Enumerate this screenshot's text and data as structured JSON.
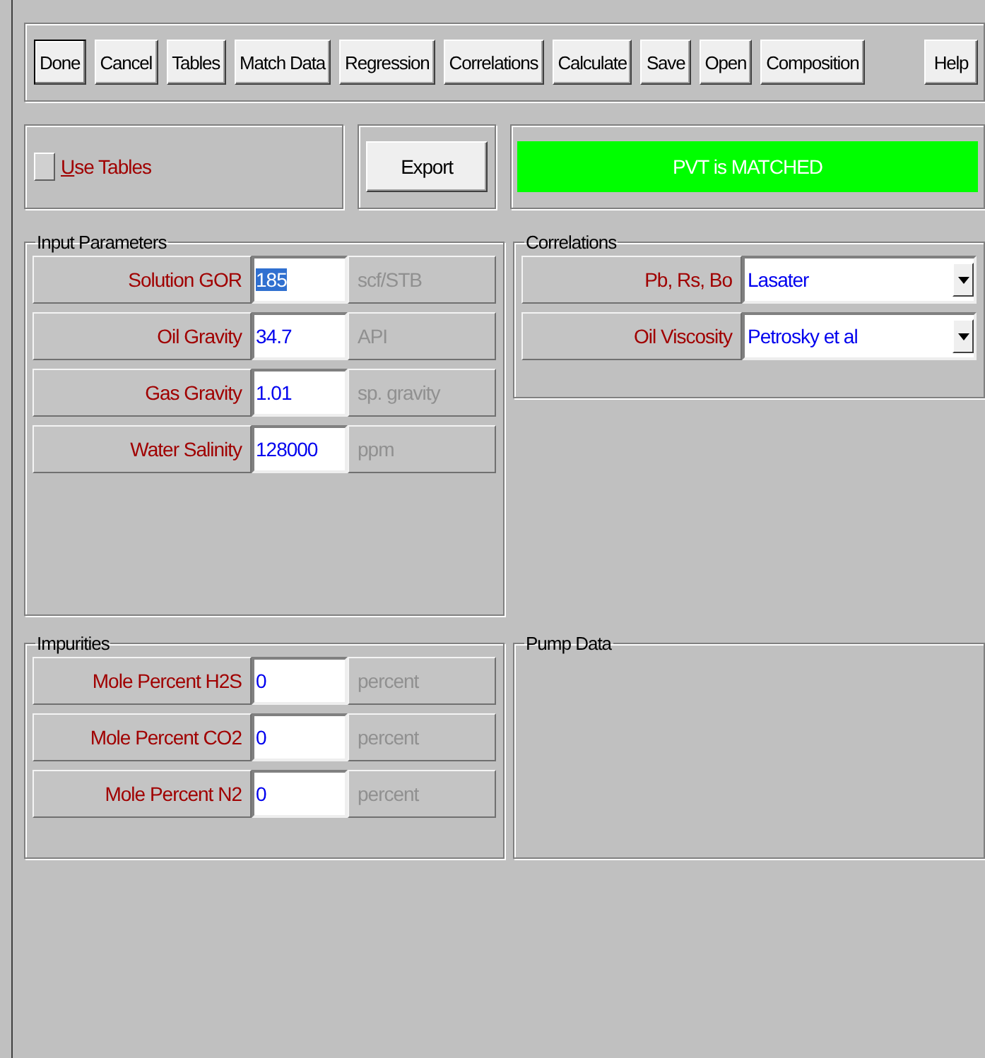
{
  "toolbar": {
    "buttons": [
      {
        "label": "Done",
        "default": true
      },
      {
        "label": "Cancel",
        "default": false
      },
      {
        "label": "Tables",
        "default": false
      },
      {
        "label": "Match Data",
        "default": false
      },
      {
        "label": "Regression",
        "default": false
      },
      {
        "label": "Correlations",
        "default": false
      },
      {
        "label": "Calculate",
        "default": false
      },
      {
        "label": "Save",
        "default": false
      },
      {
        "label": "Open",
        "default": false
      },
      {
        "label": "Composition",
        "default": false
      }
    ],
    "help_button": "Help"
  },
  "use_tables": {
    "label": "Use Tables",
    "checked": false
  },
  "export_button": "Export",
  "status": {
    "text": "PVT is MATCHED",
    "color": "#00ff00"
  },
  "input_parameters": {
    "title": "Input Parameters",
    "rows": [
      {
        "label": "Solution GOR",
        "value": "185",
        "unit": "scf/STB",
        "highlighted": true
      },
      {
        "label": "Oil Gravity",
        "value": "34.7",
        "unit": "API",
        "highlighted": false
      },
      {
        "label": "Gas Gravity",
        "value": "1.01",
        "unit": "sp. gravity",
        "highlighted": false
      },
      {
        "label": "Water Salinity",
        "value": "128000",
        "unit": "ppm",
        "highlighted": false
      }
    ]
  },
  "correlations": {
    "title": "Correlations",
    "rows": [
      {
        "label": "Pb, Rs, Bo",
        "value": "Lasater"
      },
      {
        "label": "Oil Viscosity",
        "value": "Petrosky et al"
      }
    ]
  },
  "impurities": {
    "title": "Impurities",
    "rows": [
      {
        "label": "Mole Percent H2S",
        "value": "0",
        "unit": "percent",
        "highlighted": false
      },
      {
        "label": "Mole Percent CO2",
        "value": "0",
        "unit": "percent",
        "highlighted": false
      },
      {
        "label": "Mole Percent N2",
        "value": "0",
        "unit": "percent",
        "highlighted": false
      }
    ]
  },
  "pump_data": {
    "title": "Pump Data"
  }
}
